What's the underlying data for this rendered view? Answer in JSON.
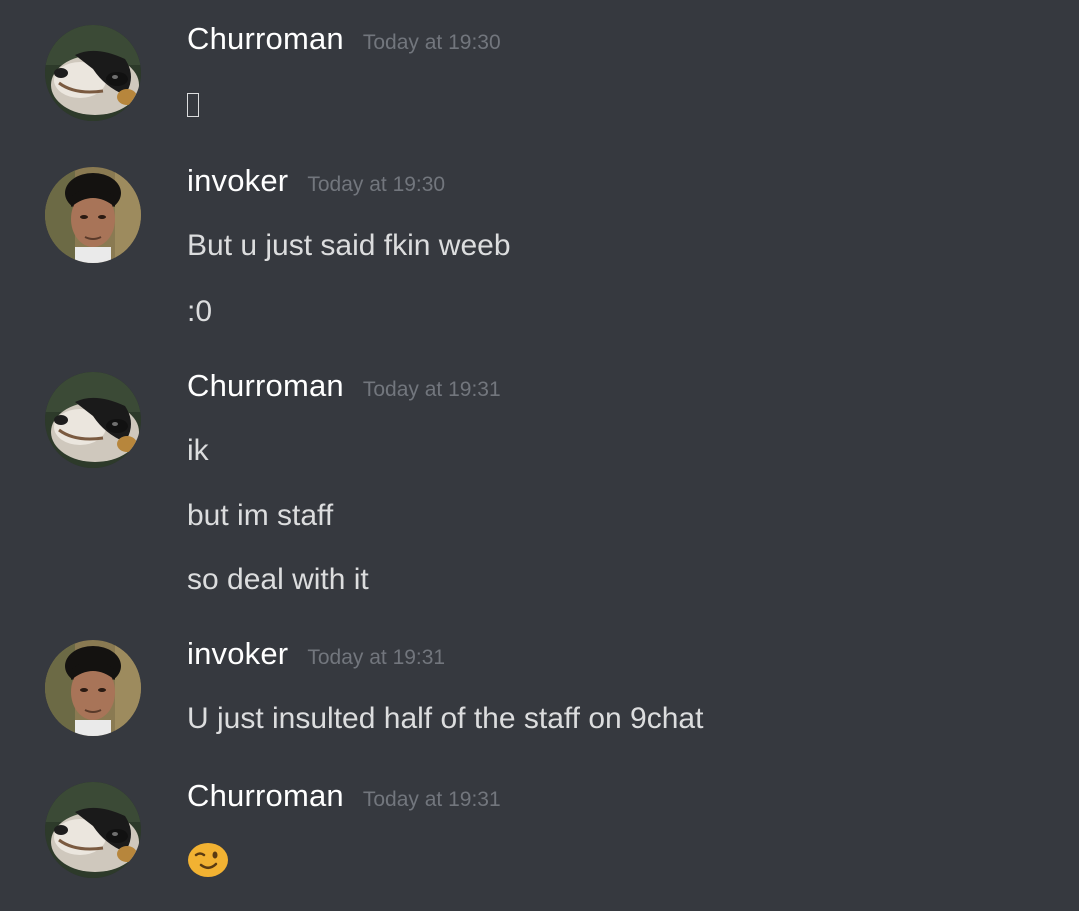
{
  "messages": [
    {
      "author": "Churroman",
      "avatar_icon": "dog-avatar-icon",
      "timestamp": "Today at 19:30",
      "lines": [
        ""
      ],
      "missing_glyph": true
    },
    {
      "author": "invoker",
      "avatar_icon": "person-avatar-icon",
      "timestamp": "Today at 19:30",
      "lines": [
        "But u just said fkin weeb",
        ":0"
      ]
    },
    {
      "author": "Churroman",
      "avatar_icon": "dog-avatar-icon",
      "timestamp": "Today at 19:31",
      "lines": [
        "ik",
        "but im staff",
        "so deal with it"
      ]
    },
    {
      "author": "invoker",
      "avatar_icon": "person-avatar-icon",
      "timestamp": "Today at 19:31",
      "lines": [
        "U just insulted half of the staff on 9chat"
      ]
    },
    {
      "author": "Churroman",
      "avatar_icon": "dog-avatar-icon",
      "timestamp": "Today at 19:31",
      "lines": [],
      "emoji": "winking-face-emoji-icon"
    }
  ],
  "colors": {
    "background": "#36393f",
    "author": "#ffffff",
    "timestamp": "#72767d",
    "message": "#dcddde",
    "emoji": "#f2b232"
  }
}
